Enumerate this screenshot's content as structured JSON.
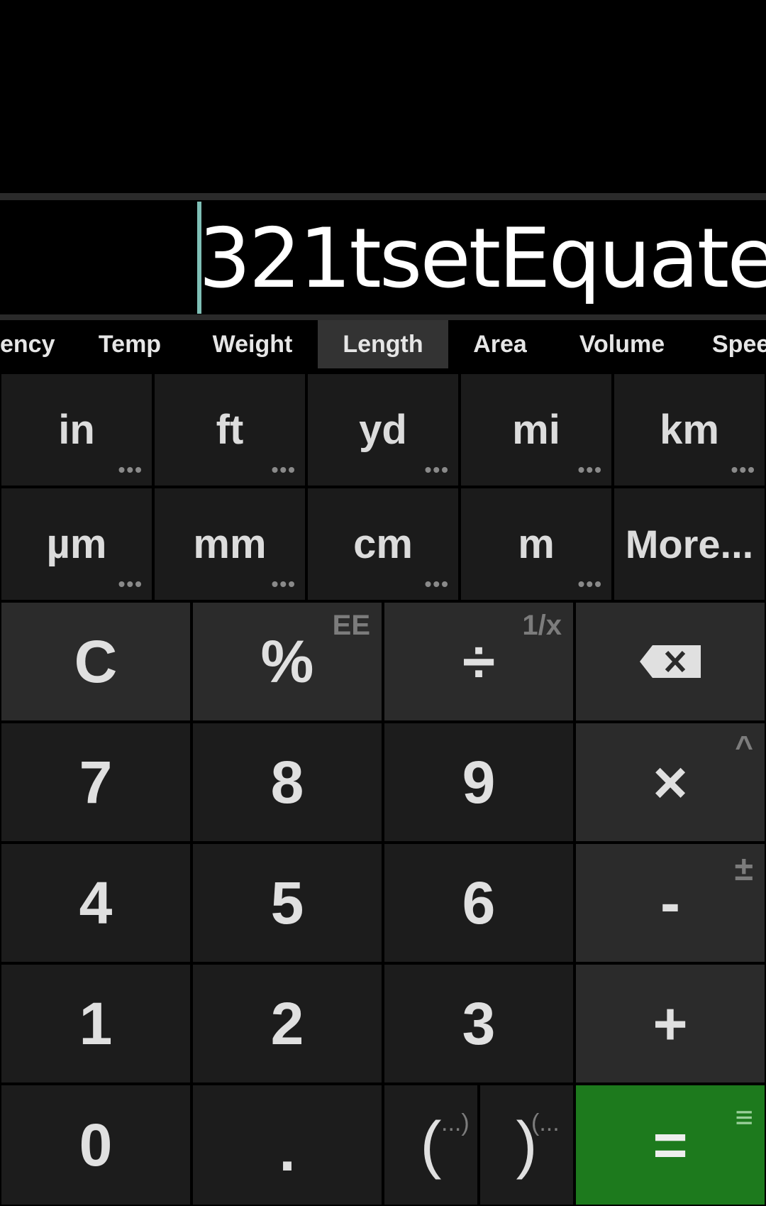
{
  "display": {
    "expression": "321tsetEquate"
  },
  "tabs": [
    {
      "label": "ency"
    },
    {
      "label": "Temp"
    },
    {
      "label": "Weight"
    },
    {
      "label": "Length",
      "active": true
    },
    {
      "label": "Area"
    },
    {
      "label": "Volume"
    },
    {
      "label": "Spee"
    }
  ],
  "units": {
    "row1": [
      "in",
      "ft",
      "yd",
      "mi",
      "km"
    ],
    "row2": [
      "µm",
      "mm",
      "cm",
      "m",
      "More..."
    ],
    "dots": "•••"
  },
  "keys": {
    "clear": "C",
    "percent": "%",
    "percent_alt": "EE",
    "divide": "÷",
    "divide_alt": "1/x",
    "backspace_icon": "backspace-icon",
    "seven": "7",
    "eight": "8",
    "nine": "9",
    "multiply": "×",
    "multiply_alt": "^",
    "four": "4",
    "five": "5",
    "six": "6",
    "minus": "-",
    "minus_alt": "±",
    "one": "1",
    "two": "2",
    "three": "3",
    "plus": "+",
    "zero": "0",
    "decimal": ".",
    "open_paren": "(",
    "open_paren_alt": "...)",
    "close_paren": ")",
    "close_paren_alt": "(...",
    "equals": "=",
    "equals_alt": "≡"
  },
  "colors": {
    "equals_bg": "#1d7a1d",
    "cursor": "#7fbfb6",
    "active_tab": "#333333"
  }
}
